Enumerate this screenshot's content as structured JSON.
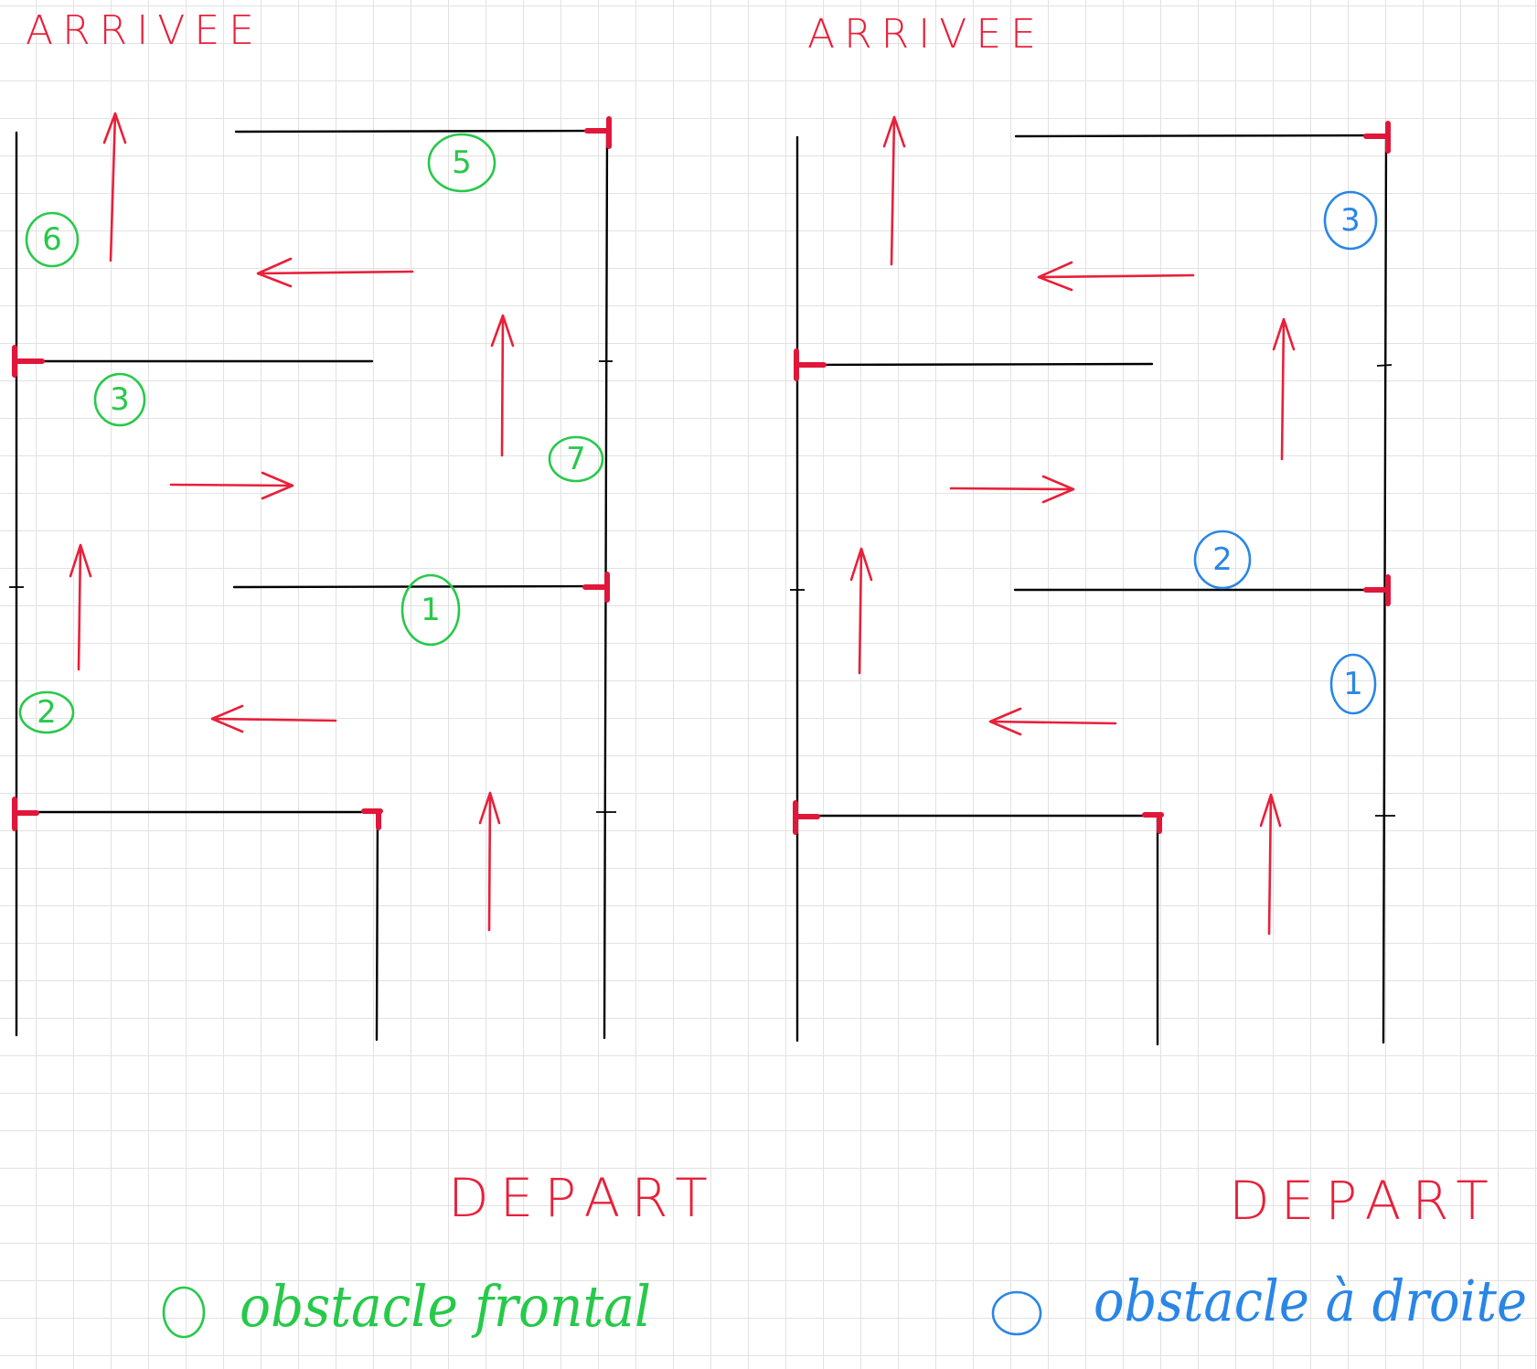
{
  "colors": {
    "arrows": "#e8203a",
    "wall_caps": "#e0173a",
    "green": "#27c94a",
    "blue": "#2a86e6",
    "walls": "#000000",
    "grid": "#e2e2e2"
  },
  "left": {
    "arrivee": "ARRIVEE",
    "depart": "DEPART",
    "markers": [
      "5",
      "6",
      "3",
      "7",
      "1",
      "2"
    ],
    "legend": "obstacle frontal"
  },
  "right": {
    "arrivee": "ARRIVEE",
    "depart": "DEPART",
    "markers": [
      "3",
      "2",
      "1"
    ],
    "legend": "obstacle à droite"
  }
}
